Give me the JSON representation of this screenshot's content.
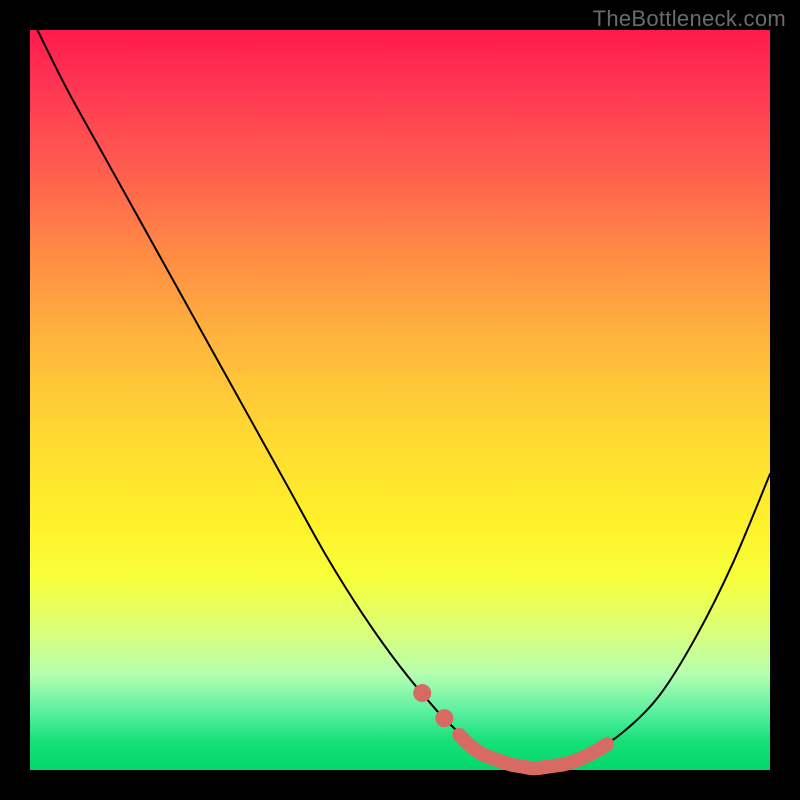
{
  "watermark": "TheBottleneck.com",
  "colors": {
    "highlight": "#d86a64",
    "curve": "#000000",
    "background_top": "#ff1a4d",
    "background_bottom": "#00d86a"
  },
  "chart_data": {
    "type": "line",
    "title": "",
    "xlabel": "",
    "ylabel": "",
    "xlim": [
      0,
      100
    ],
    "ylim": [
      0,
      100
    ],
    "x": [
      1,
      5,
      10,
      15,
      20,
      25,
      30,
      35,
      40,
      45,
      50,
      55,
      58,
      60,
      62,
      65,
      68,
      70,
      73,
      76,
      80,
      85,
      90,
      95,
      100
    ],
    "values": [
      100,
      92,
      83,
      74,
      65,
      56,
      47,
      38,
      29,
      21,
      14,
      8,
      5,
      3,
      2,
      1,
      0.5,
      0.7,
      1.2,
      2.5,
      5,
      10,
      18,
      28,
      40
    ],
    "annotations": {
      "highlighted_range_x": [
        58,
        78
      ],
      "highlighted_dots_x": [
        53,
        56
      ]
    }
  }
}
